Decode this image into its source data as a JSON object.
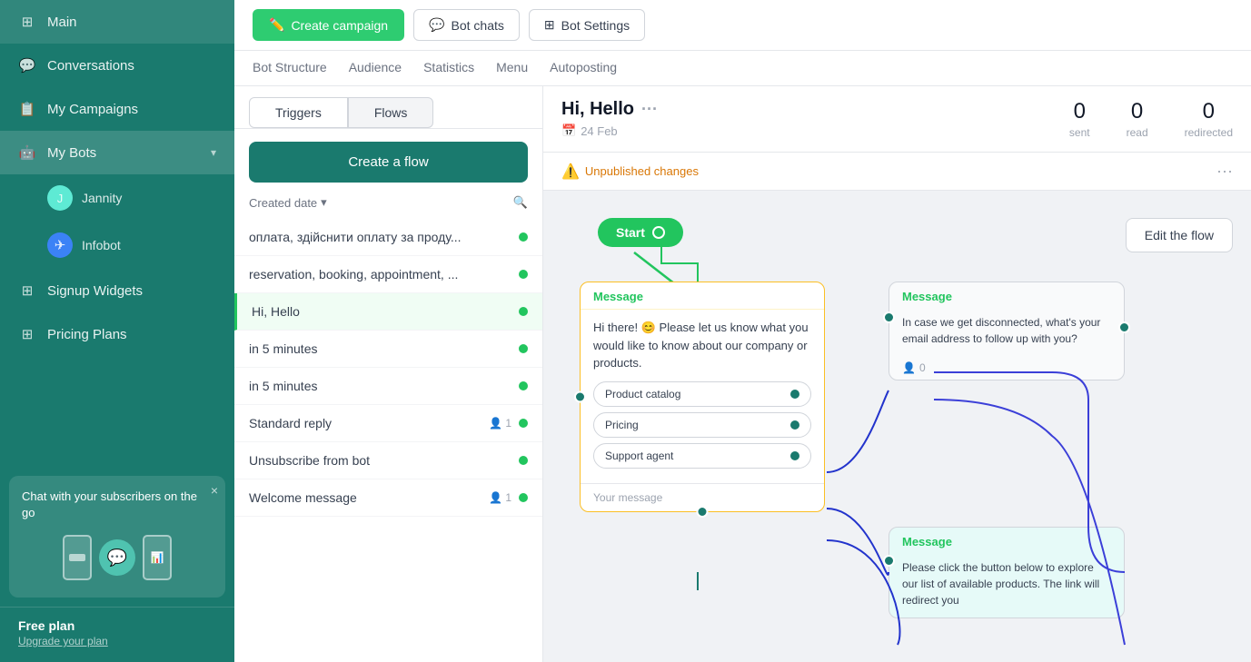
{
  "sidebar": {
    "items": [
      {
        "id": "main",
        "label": "Main",
        "icon": "⊞"
      },
      {
        "id": "conversations",
        "label": "Conversations",
        "icon": "○"
      },
      {
        "id": "my-campaigns",
        "label": "My Campaigns",
        "icon": "👤"
      },
      {
        "id": "my-bots",
        "label": "My Bots",
        "icon": "○",
        "hasChevron": true
      },
      {
        "id": "jannity",
        "label": "Jannity",
        "isBot": true,
        "avatar": "J"
      },
      {
        "id": "infobot",
        "label": "Infobot",
        "isBot": true,
        "avatarIcon": "✈"
      },
      {
        "id": "signup-widgets",
        "label": "Signup Widgets",
        "icon": "⊞"
      },
      {
        "id": "pricing-plans",
        "label": "Pricing Plans",
        "icon": "⊞"
      }
    ],
    "promo": {
      "text": "Chat with your subscribers on the go",
      "close_label": "×"
    },
    "plan": {
      "name": "Free plan",
      "upgrade_label": "Upgrade your plan"
    }
  },
  "topbar": {
    "create_campaign_label": "Create campaign",
    "bot_chats_label": "Bot chats",
    "bot_settings_label": "Bot Settings"
  },
  "subnav": {
    "items": [
      {
        "label": "Bot Structure"
      },
      {
        "label": "Audience"
      },
      {
        "label": "Statistics"
      },
      {
        "label": "Menu"
      },
      {
        "label": "Autoposting"
      }
    ]
  },
  "left_panel": {
    "tabs": [
      {
        "label": "Triggers",
        "active": false
      },
      {
        "label": "Flows",
        "active": true
      }
    ],
    "create_flow_label": "Create a flow",
    "filter_label": "Created date",
    "flows": [
      {
        "id": "1",
        "name": "оплата, здійснити оплату за проду...",
        "active": true
      },
      {
        "id": "2",
        "name": "reservation, booking, appointment, ...",
        "active": true
      },
      {
        "id": "3",
        "name": "Hi, Hello",
        "active": true,
        "selected": true
      },
      {
        "id": "4",
        "name": "in 5 minutes",
        "active": true
      },
      {
        "id": "5",
        "name": "in 5 minutes",
        "active": true
      },
      {
        "id": "6",
        "name": "Standard reply",
        "active": true,
        "userCount": 1
      },
      {
        "id": "7",
        "name": "Unsubscribe from bot",
        "active": true
      },
      {
        "id": "8",
        "name": "Welcome message",
        "active": true,
        "userCount": 1
      }
    ]
  },
  "right_panel": {
    "flow_title": "Hi, Hello",
    "flow_date": "24 Feb",
    "stats": [
      {
        "value": "0",
        "label": "sent"
      },
      {
        "value": "0",
        "label": "read"
      },
      {
        "value": "0",
        "label": "redirected"
      }
    ],
    "unpublished_label": "Unpublished changes",
    "edit_flow_label": "Edit the flow",
    "start_label": "Start",
    "message1": {
      "header": "Message",
      "text": "Hi there! 😊 Please let us know what you would like to know about our company or products.",
      "buttons": [
        "Product catalog",
        "Pricing",
        "Support agent"
      ],
      "placeholder": "Your message"
    },
    "message2": {
      "header": "Message",
      "text": "In case we get disconnected, what's your email address to follow up with you?",
      "userCount": "0"
    },
    "message3": {
      "header": "Message",
      "text": "Please click the button below to explore our list of available products. The link will redirect you"
    }
  }
}
